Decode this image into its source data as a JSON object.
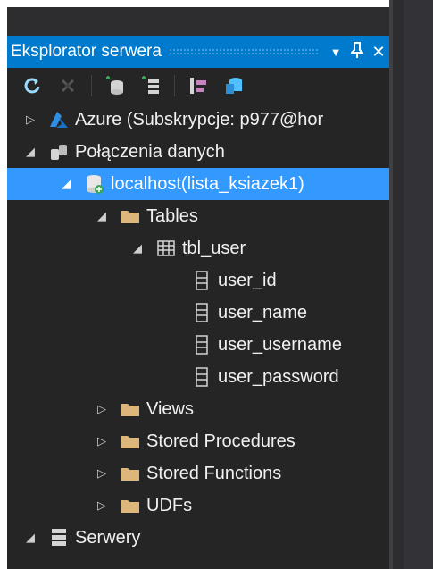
{
  "panel": {
    "title": "Eksplorator serwera",
    "buttons": {
      "dropdown": "▼",
      "pin": "ᛘ",
      "close": "✕"
    }
  },
  "toolbar": {
    "items": [
      "refresh-icon",
      "stop-icon",
      "connect-to-database-icon",
      "connect-to-server-icon",
      "filter-icon",
      "sql-server-icon"
    ]
  },
  "tree": [
    {
      "label": "Azure (Subskrypcje: p977@hor",
      "icon": "azure-icon",
      "expanded": false
    },
    {
      "label": "Połączenia danych",
      "icon": "data-connections-icon",
      "expanded": true
    },
    {
      "label": "localhost(lista_ksiazek1)",
      "icon": "database-icon",
      "expanded": true,
      "selected": true
    },
    {
      "label": "Tables",
      "icon": "folder-icon",
      "expanded": true
    },
    {
      "label": "tbl_user",
      "icon": "table-icon",
      "expanded": true
    },
    {
      "label": "user_id",
      "icon": "column-icon"
    },
    {
      "label": "user_name",
      "icon": "column-icon"
    },
    {
      "label": "user_username",
      "icon": "column-icon"
    },
    {
      "label": "user_password",
      "icon": "column-icon"
    },
    {
      "label": "Views",
      "icon": "folder-icon",
      "expanded": false
    },
    {
      "label": "Stored Procedures",
      "icon": "folder-icon",
      "expanded": false
    },
    {
      "label": "Stored Functions",
      "icon": "folder-icon",
      "expanded": false
    },
    {
      "label": "UDFs",
      "icon": "folder-icon",
      "expanded": false
    },
    {
      "label": "Serwery",
      "icon": "servers-icon",
      "expanded": true
    }
  ],
  "colors": {
    "accent": "#007acc",
    "selection": "#3399ff",
    "background": "#252526",
    "folder": "#dcb67a"
  }
}
